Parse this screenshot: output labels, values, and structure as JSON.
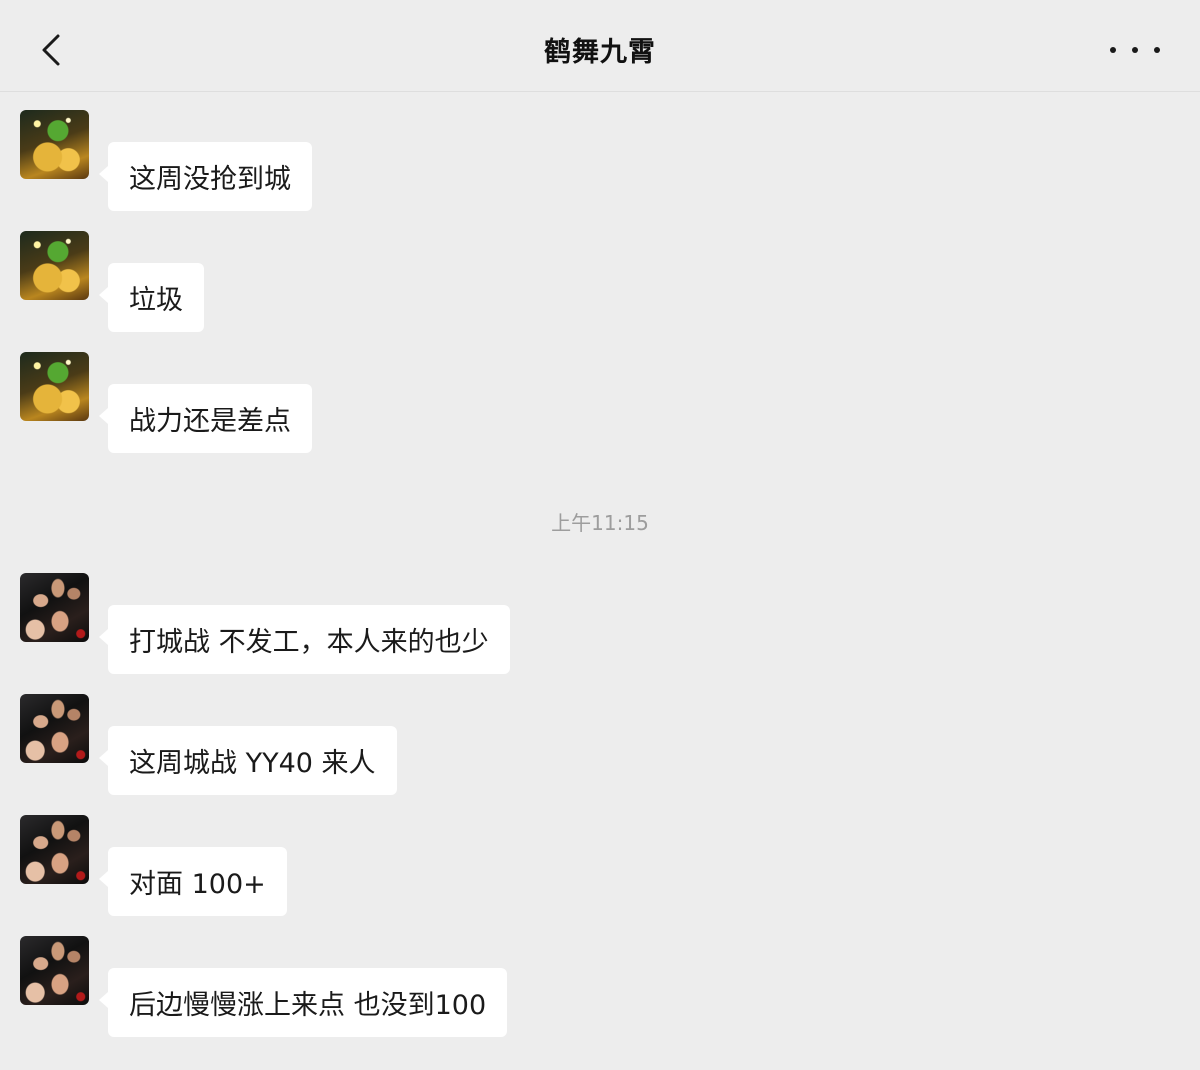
{
  "header": {
    "title": "鹤舞九霄",
    "back_icon": "chevron-left-icon",
    "more_icon": "more-dots-icon"
  },
  "messages": [
    {
      "sender_avatar": "gold-avatar",
      "text": "这周没抢到城"
    },
    {
      "sender_avatar": "gold-avatar",
      "text": "垃圾"
    },
    {
      "sender_avatar": "gold-avatar",
      "text": "战力还是差点"
    },
    {
      "sender_avatar": "group-avatar",
      "text": "打城战 不发工，本人来的也少"
    },
    {
      "sender_avatar": "group-avatar",
      "text": "这周城战 YY40 来人"
    },
    {
      "sender_avatar": "group-avatar",
      "text": "对面 100+"
    },
    {
      "sender_avatar": "group-avatar",
      "text": "后边慢慢涨上来点 也没到100"
    }
  ],
  "timestamp": "上午11:15",
  "colors": {
    "background": "#ededed",
    "bubble": "#ffffff",
    "text": "#1a1a1a",
    "timestamp": "#9d9d9d"
  }
}
